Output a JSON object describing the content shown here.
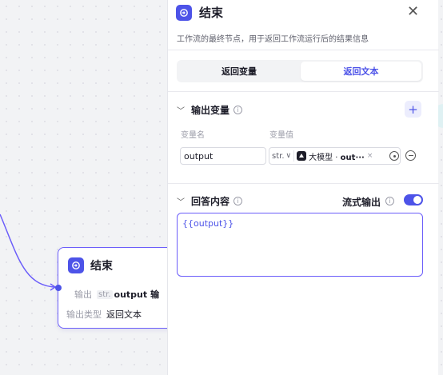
{
  "canvas_node": {
    "title": "结束",
    "output_label": "输出",
    "output_type_tag": "str.",
    "output_value": "output",
    "output_suffix": "输",
    "output_type_label": "输出类型",
    "output_type_value": "返回文本"
  },
  "panel": {
    "title": "结束",
    "close": "✕",
    "description": "工作流的最终节点，用于返回工作流运行后的结果信息",
    "tabs": [
      "返回变量",
      "返回文本"
    ],
    "active_tab": "返回文本",
    "output_vars": {
      "title": "输出变量",
      "add": "+",
      "col_name": "变量名",
      "col_value": "变量值",
      "row": {
        "name": "output",
        "type": "str.",
        "ref_source": "大模型",
        "ref_var": "out···",
        "clear": "×"
      }
    },
    "answer": {
      "title": "回答内容",
      "stream_label": "流式输出",
      "stream_on": true,
      "content": "{{output}}"
    },
    "info_glyph": "i"
  },
  "colors": {
    "accent": "#4d53e8",
    "border_active": "#6b5dfa"
  }
}
